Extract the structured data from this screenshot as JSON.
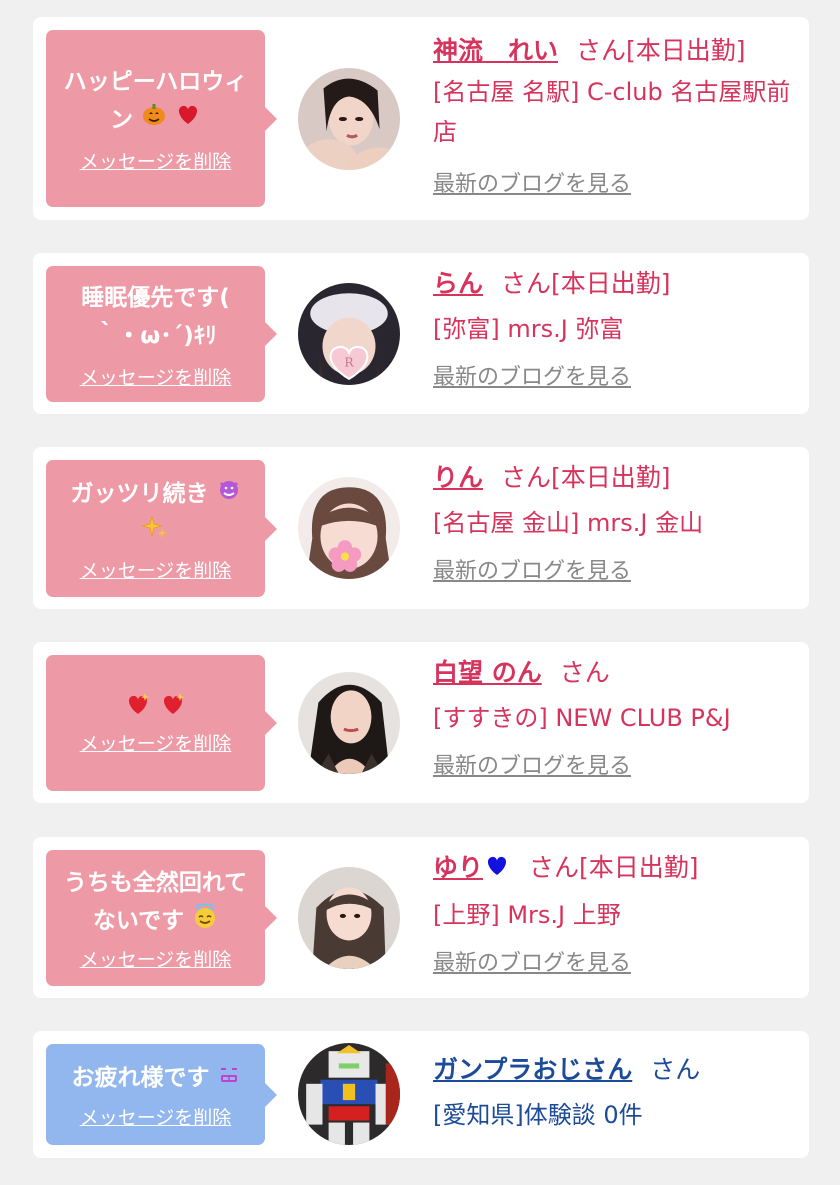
{
  "colors": {
    "bubble_pink": "#ee9aa6",
    "bubble_blue": "#92b6ee",
    "text_pink": "#d6345d",
    "text_blue": "#1c4b97",
    "link_gray": "#888888",
    "background": "#f0f0f0"
  },
  "messages": [
    {
      "message": "ハッピーハロウィン",
      "emoji": [
        "pumpkin-icon",
        "heart-icon"
      ],
      "delete_label": "メッセージを削除",
      "cast_name": "神流　れい",
      "honorific": "さん",
      "status": "[本日出勤]",
      "shop": "[名古屋 名駅] C-club 名古屋駅前店",
      "blog_link": "最新のブログを見る"
    },
    {
      "message": "睡眠優先です( ｀・ω･´)ｷﾘ",
      "emoji": [],
      "delete_label": "メッセージを削除",
      "cast_name": "らん",
      "honorific": "さん",
      "status": "[本日出勤]",
      "shop": "[弥富] mrs.J 弥富",
      "blog_link": "最新のブログを見る"
    },
    {
      "message": "ガッツリ続き",
      "emoji": [
        "grinning-devil-icon",
        "sparkles-icon"
      ],
      "delete_label": "メッセージを削除",
      "cast_name": "りん",
      "honorific": "さん",
      "status": "[本日出勤]",
      "shop": "[名古屋 金山] mrs.J 金山",
      "blog_link": "最新のブログを見る"
    },
    {
      "message": "",
      "emoji": [
        "sparkling-heart-icon",
        "sparkling-heart-icon"
      ],
      "delete_label": "メッセージを削除",
      "cast_name": "白望 のん",
      "honorific": "さん",
      "status": "",
      "shop": "[すすきの] NEW CLUB P&J",
      "blog_link": "最新のブログを見る"
    },
    {
      "message": "うちも全然回れてないです",
      "emoji": [
        "halo-face-icon"
      ],
      "delete_label": "メッセージを削除",
      "cast_name": "ゆり",
      "name_emoji": "blue-heart-icon",
      "honorific": "さん",
      "status": "[本日出勤]",
      "shop": "[上野] Mrs.J 上野",
      "blog_link": "最新のブログを見る"
    },
    {
      "message": "お疲れ様です",
      "emoji": [
        "bar-face-icon"
      ],
      "delete_label": "メッセージを削除",
      "cast_name": "ガンプラおじさん",
      "honorific": "さん",
      "status": "",
      "shop": "[愛知県]体験談 0件",
      "blog_link": ""
    }
  ]
}
